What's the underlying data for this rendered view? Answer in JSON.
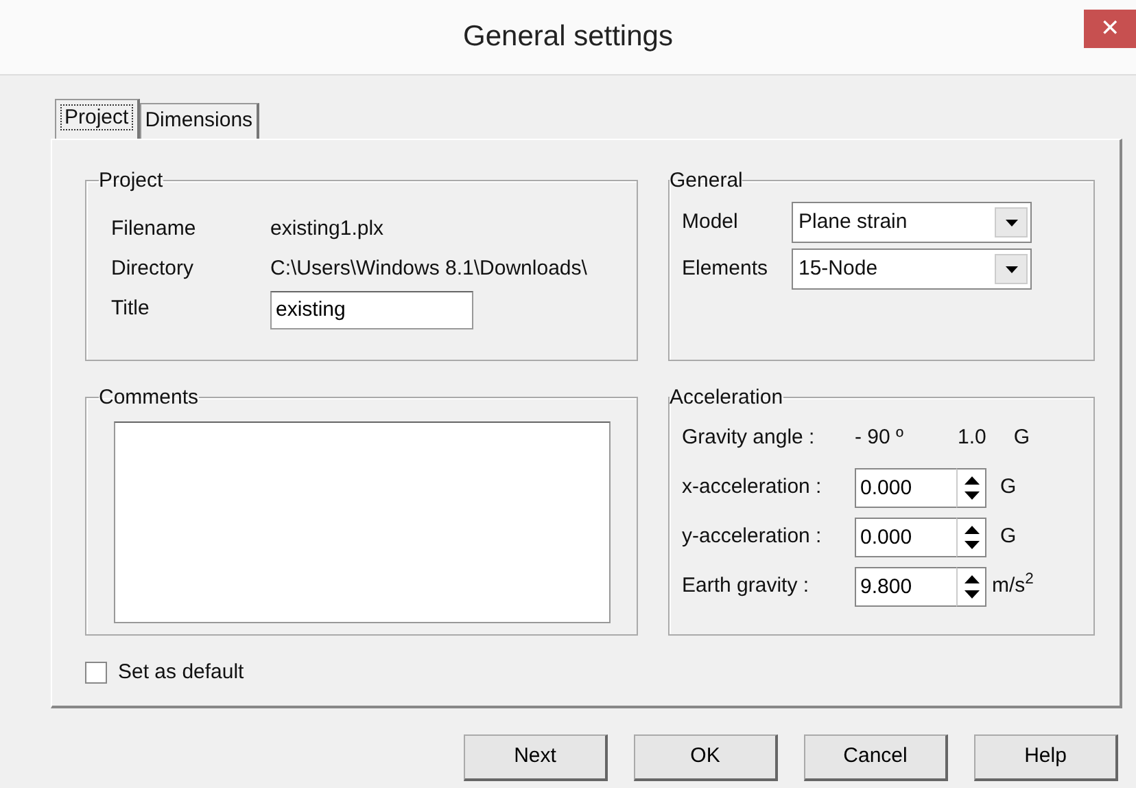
{
  "window": {
    "title": "General settings",
    "close": "✕"
  },
  "tabs": [
    {
      "label": "Project",
      "selected": true
    },
    {
      "label": "Dimensions",
      "selected": false
    }
  ],
  "project": {
    "legend": "Project",
    "rows": [
      {
        "label": "Filename",
        "kind": "text",
        "value": "existing1.plx"
      },
      {
        "label": "Directory",
        "kind": "text",
        "value": "C:\\Users\\Windows 8.1\\Downloads\\"
      },
      {
        "label": "Title",
        "kind": "field",
        "value": "existing"
      }
    ]
  },
  "general": {
    "legend": "General",
    "rows": [
      {
        "label": "Model",
        "value": "Plane strain"
      },
      {
        "label": "Elements",
        "value": "15-Node"
      }
    ]
  },
  "comments": {
    "legend": "Comments"
  },
  "acceleration": {
    "legend": "Acceleration",
    "rows": [
      {
        "kind": "readout",
        "label": "Gravity angle :",
        "value": "- 90 º",
        "extra": "1.0",
        "unit": "G"
      },
      {
        "kind": "spin",
        "label": "x-acceleration :",
        "value": "0.000",
        "unit": "G"
      },
      {
        "kind": "spin",
        "label": "y-acceleration :",
        "value": "0.000",
        "unit": "G"
      },
      {
        "kind": "spin",
        "label": "Earth gravity :",
        "value": "9.800",
        "unit": "m/s$^{2}$"
      }
    ]
  },
  "set_as_default": {
    "label": "Set as default",
    "checked": false
  },
  "buttons": [
    "Next",
    "OK",
    "Cancel",
    "Help"
  ]
}
